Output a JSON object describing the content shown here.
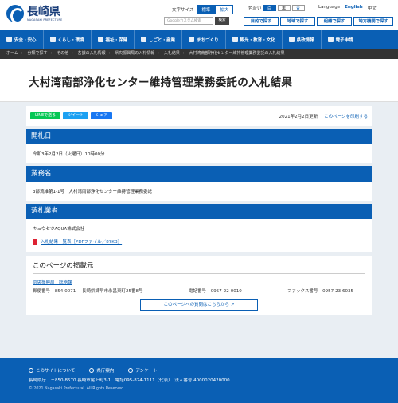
{
  "site": {
    "name": "長崎県",
    "name_en": "NAGASAKI PREFECTURE"
  },
  "topbar": {
    "font_size_label": "文字サイズ",
    "font_standard": "標準",
    "font_large": "拡大",
    "color_label": "色合い",
    "color_white": "白",
    "color_black": "黒",
    "color_blue": "青",
    "language_label": "Language",
    "lang_en": "English",
    "lang_zh": "中文",
    "search_placeholder": "Googleカスタム検索",
    "search_button": "検索",
    "quick": [
      "目的で探す",
      "地域で探す",
      "組織で探す",
      "地方機関で探す"
    ]
  },
  "nav": {
    "items": [
      "安全・安心",
      "くらし・環境",
      "福祉・保健",
      "しごと・産業",
      "まちづくり",
      "観光・教育・文化",
      "県政情報",
      "電子申請"
    ]
  },
  "breadcrumb": [
    "ホーム",
    "分類で探す",
    "その他",
    "各課の入札情報",
    "県央振興局の入札情報",
    "入札結果",
    "大村湾南部浄化センター維持管理業務委託の入札結果"
  ],
  "page": {
    "title": "大村湾南部浄化センター維持管理業務委託の入札結果",
    "share_line": "LINEで送る",
    "share_tweet": "ツイート",
    "share_fb": "シェア",
    "updated": "2021年2月2日更新",
    "print": "このページを印刷する"
  },
  "sections": [
    {
      "heading": "開札日",
      "body": "令和3年2月2日（火曜日）10時00分"
    },
    {
      "heading": "業務名",
      "body": "3部流維第1-1号　大村湾南部浄化センター維持管理業務委託"
    },
    {
      "heading": "落札業者",
      "body": "キュウセツAQUA株式会社",
      "link": "入札結果一覧表［PDFファイル／87KB］"
    }
  ],
  "contact": {
    "heading": "このページの掲載元",
    "dept": "県央振興局　総務課",
    "postal_label": "郵便番号",
    "postal": "854-0071",
    "address": "長崎県諫早市永昌東町25番8号",
    "phone_label": "電話番号",
    "phone": "0957-22-0010",
    "fax_label": "ファックス番号",
    "fax": "0957-23-6035",
    "inquiry": "このページへの質問はこちらから"
  },
  "footer": {
    "links": [
      "このサイトについて",
      "県庁案内",
      "アンケート"
    ],
    "address": "長崎県庁　〒850-8570 長崎市尾上町3-1　電話095-824-1111（代表）　法人番号 4000020420000",
    "copyright": "© 2021 Nagasaki Prefectural. All Rights Reserved."
  },
  "colors": {
    "primary": "#0a5fb4",
    "breadcrumb_bg": "#333333",
    "main_bg": "#e9eef3",
    "line": "#06c755",
    "twitter": "#1da1f2",
    "facebook": "#1877f2"
  }
}
